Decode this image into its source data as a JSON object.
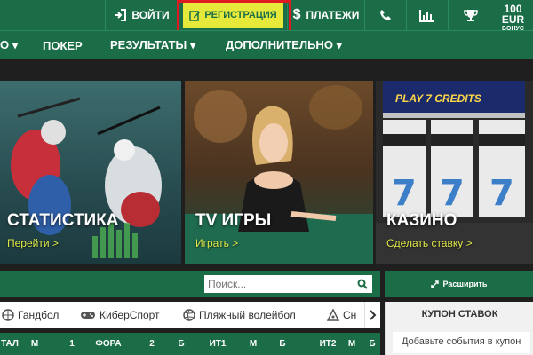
{
  "topbar": {
    "login_label": "ВОЙТИ",
    "register_label": "РЕГИСТРАЦИЯ",
    "payments_label": "ПЛАТЕЖИ",
    "bonus_amount": "100 EUR",
    "bonus_label": "БОНУС"
  },
  "mainnav": {
    "items": [
      {
        "label": "О ▾"
      },
      {
        "label": "ПОКЕР"
      },
      {
        "label": "РЕЗУЛЬТАТЫ ▾"
      },
      {
        "label": "ДОПОЛНИТЕЛЬНО ▾"
      }
    ]
  },
  "banners": [
    {
      "title": "СТАТИСТИКА",
      "link": "Перейти >"
    },
    {
      "title": "TV ИГРЫ",
      "link": "Играть >"
    },
    {
      "title": "КАЗИНО",
      "link": "Сделать ставку >"
    }
  ],
  "casino_sign": "PLAY 7 CREDITS",
  "search": {
    "placeholder": "Поиск..."
  },
  "sports": [
    {
      "label": "Гандбол",
      "icon": "handball-icon"
    },
    {
      "label": "КиберСпорт",
      "icon": "gamepad-icon"
    },
    {
      "label": "Пляжный волейбол",
      "icon": "volleyball-icon"
    },
    {
      "label": "Сн",
      "icon": "snooker-icon"
    }
  ],
  "columns": [
    "ТАЛ",
    "М",
    "1",
    "ФОРА",
    "2",
    "Б",
    "ИТ1",
    "М",
    "Б",
    "ИТ2",
    "М",
    "Б"
  ],
  "sidebar": {
    "expand_label": "Расширить",
    "coupon_title": "КУПОН СТАВОК",
    "coupon_text": "Добавьте события в купон"
  },
  "colors": {
    "brand_green": "#1b6d48",
    "register_yellow": "#e6e93a",
    "highlight_red": "#e01a22",
    "link_yellow": "#dfe84a"
  }
}
